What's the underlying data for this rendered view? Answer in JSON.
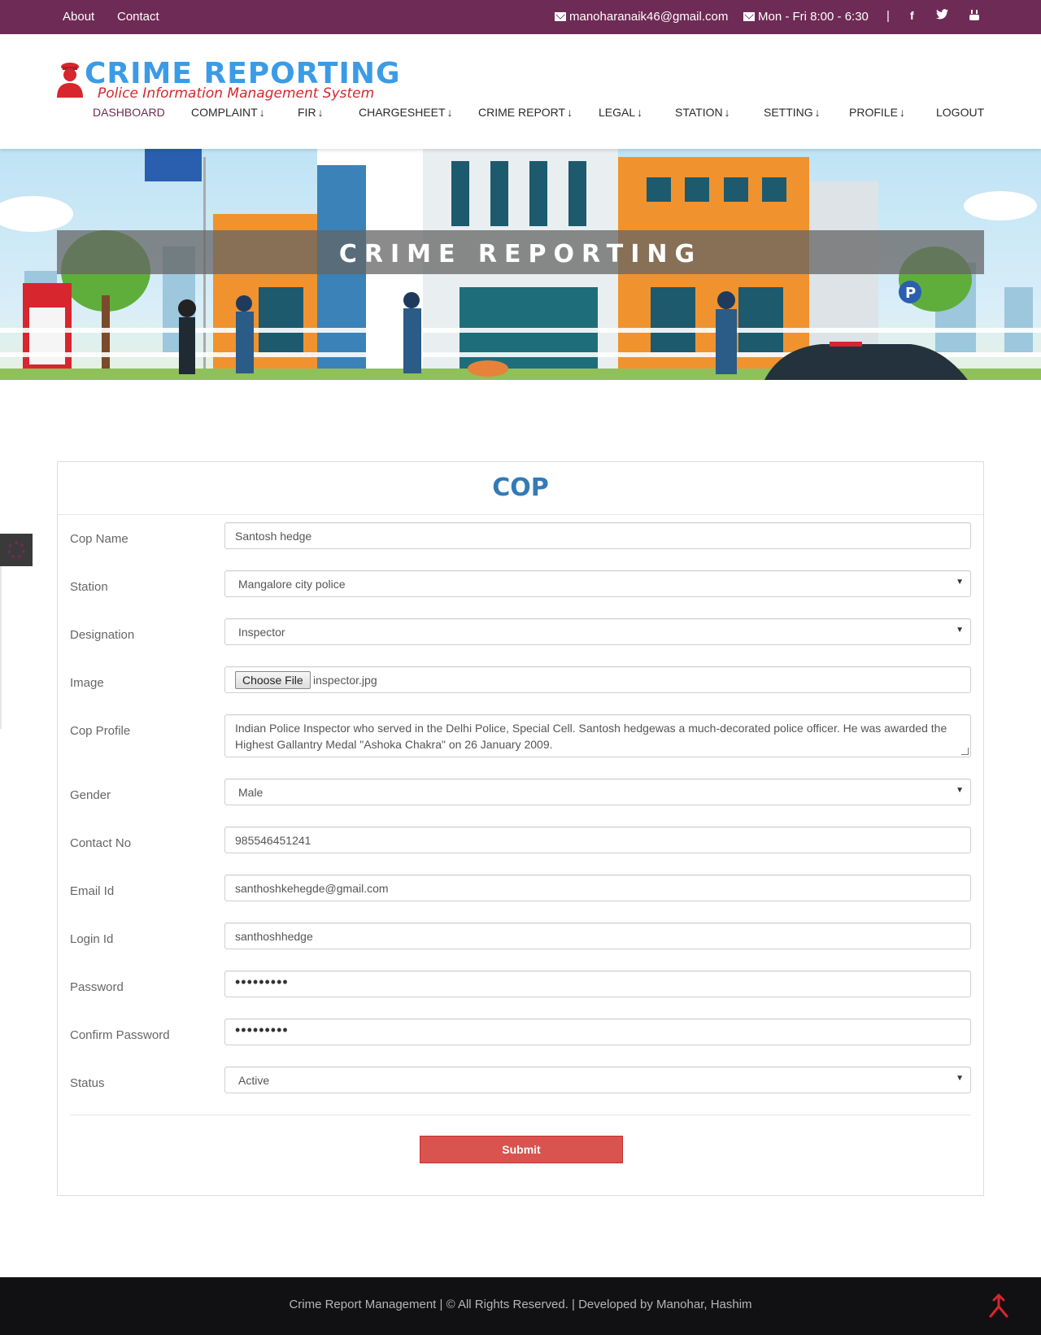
{
  "topbar": {
    "about": "About",
    "contact": "Contact",
    "email": "manoharanaik46@gmail.com",
    "hours": "Mon - Fri 8:00 - 6:30",
    "separator": "|",
    "social": [
      "facebook-icon",
      "twitter-icon",
      "youtube-icon"
    ]
  },
  "logo": {
    "title": "CRIME REPORTING",
    "subtitle": "Police Information Management System"
  },
  "nav": {
    "items": [
      {
        "label": "DASHBOARD",
        "dropdown": false
      },
      {
        "label": "COMPLAINT",
        "dropdown": true
      },
      {
        "label": "FIR",
        "dropdown": true
      },
      {
        "label": "CHARGESHEET",
        "dropdown": true
      },
      {
        "label": "CRIME REPORT",
        "dropdown": true
      },
      {
        "label": "LEGAL",
        "dropdown": true
      },
      {
        "label": "STATION",
        "dropdown": true
      },
      {
        "label": "SETTING",
        "dropdown": true
      },
      {
        "label": "PROFILE",
        "dropdown": true
      },
      {
        "label": "LOGOUT",
        "dropdown": false
      }
    ],
    "arrow": "🡻"
  },
  "banner": {
    "title": "CRIME REPORTING"
  },
  "form": {
    "title": "COP",
    "fields": {
      "cop_name": {
        "label": "Cop Name",
        "value": "Santosh hedge"
      },
      "station": {
        "label": "Station",
        "value": "Mangalore city police"
      },
      "designation": {
        "label": "Designation",
        "value": "Inspector"
      },
      "image": {
        "label": "Image",
        "button": "Choose File",
        "file": "inspector.jpg"
      },
      "profile": {
        "label": "Cop Profile",
        "value": "Indian Police Inspector who served in the Delhi Police, Special Cell. Santosh hedgewas a much-decorated police officer. He was awarded the Highest Gallantry Medal \"Ashoka Chakra\" on 26 January 2009."
      },
      "gender": {
        "label": "Gender",
        "value": "Male"
      },
      "contact": {
        "label": "Contact No",
        "value": "985546451241"
      },
      "email": {
        "label": "Email Id",
        "value": "santhoshkehegde@gmail.com"
      },
      "login": {
        "label": "Login Id",
        "value": "santhoshhedge"
      },
      "password": {
        "label": "Password",
        "value": "•••••••••"
      },
      "confirm_password": {
        "label": "Confirm Password",
        "value": "•••••••••"
      },
      "status": {
        "label": "Status",
        "value": "Active"
      }
    },
    "submit": "Submit"
  },
  "footer": {
    "text": "Crime Report Management | © All Rights Reserved. | Developed by Manohar, Hashim"
  },
  "colors": {
    "topbar": "#6e2b55",
    "logo_blue": "#3b9be6",
    "logo_red": "#d7262e",
    "title_blue": "#337ab7",
    "submit_red": "#d9534f",
    "footer": "#111114"
  }
}
